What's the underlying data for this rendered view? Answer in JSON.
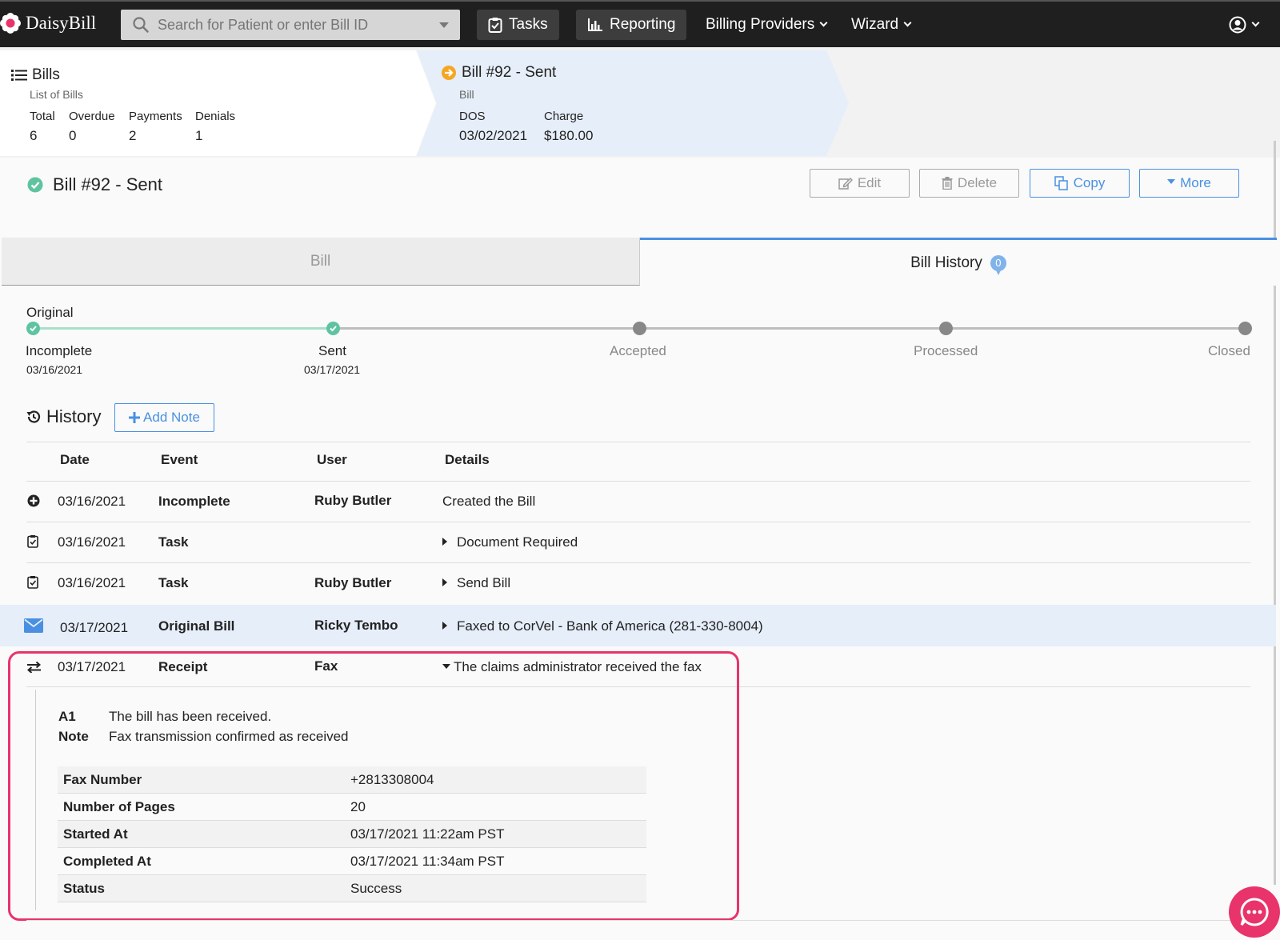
{
  "nav": {
    "brand": "DaisyBill",
    "search_placeholder": "Search for Patient or enter Bill ID",
    "tasks": "Tasks",
    "reporting": "Reporting",
    "billing_providers": "Billing Providers",
    "wizard": "Wizard"
  },
  "breadcrumb": {
    "bills": {
      "title": "Bills",
      "subtitle": "List of Bills",
      "stats": [
        {
          "label": "Total",
          "value": "6"
        },
        {
          "label": "Overdue",
          "value": "0"
        },
        {
          "label": "Payments",
          "value": "2"
        },
        {
          "label": "Denials",
          "value": "1"
        }
      ]
    },
    "bill": {
      "title": "Bill #92 - Sent",
      "subtitle": "Bill",
      "dos_label": "DOS",
      "dos_value": "03/02/2021",
      "charge_label": "Charge",
      "charge_value": "$180.00"
    }
  },
  "page": {
    "title": "Bill #92 - Sent",
    "actions": {
      "edit": "Edit",
      "delete": "Delete",
      "copy": "Copy",
      "more": "More"
    }
  },
  "tabs": {
    "bill": "Bill",
    "history": "Bill History",
    "history_badge": "0"
  },
  "timeline": {
    "title": "Original",
    "steps": [
      {
        "label": "Incomplete",
        "date": "03/16/2021",
        "done": true
      },
      {
        "label": "Sent",
        "date": "03/17/2021",
        "done": true
      },
      {
        "label": "Accepted",
        "date": "",
        "done": false
      },
      {
        "label": "Processed",
        "date": "",
        "done": false
      },
      {
        "label": "Closed",
        "date": "",
        "done": false
      }
    ]
  },
  "history": {
    "title": "History",
    "add_note": "Add Note",
    "columns": [
      "Date",
      "Event",
      "User",
      "Details"
    ],
    "rows": [
      {
        "icon": "plus-circle-icon",
        "date": "03/16/2021",
        "event": "Incomplete",
        "user": "Ruby Butler",
        "details": "Created the Bill"
      },
      {
        "icon": "task-icon",
        "date": "03/16/2021",
        "event": "Task",
        "user": "",
        "details": "Document Required"
      },
      {
        "icon": "task-icon",
        "date": "03/16/2021",
        "event": "Task",
        "user": "Ruby Butler",
        "details": "Send Bill"
      },
      {
        "icon": "envelope-icon",
        "date": "03/17/2021",
        "event": "Original Bill",
        "user": "Ricky Tembo",
        "details": "Faxed to CorVel - Bank of America (281-330-8004)"
      },
      {
        "icon": "exchange-icon",
        "date": "03/17/2021",
        "event": "Receipt",
        "user": "Fax",
        "details": "The claims administrator received the fax"
      }
    ],
    "receipt": {
      "code_key": "A1",
      "code_value": "The bill has been received.",
      "note_key": "Note",
      "note_value": "Fax transmission confirmed as received",
      "details": [
        {
          "key": "Fax Number",
          "value": "+2813308004"
        },
        {
          "key": "Number of Pages",
          "value": "20"
        },
        {
          "key": "Started At",
          "value": "03/17/2021 11:22am PST"
        },
        {
          "key": "Completed At",
          "value": "03/17/2021 11:34am PST"
        },
        {
          "key": "Status",
          "value": "Success"
        }
      ]
    }
  },
  "colors": {
    "accent": "#4a90e2",
    "success": "#5ec4a0",
    "highlight": "#e8336b"
  }
}
